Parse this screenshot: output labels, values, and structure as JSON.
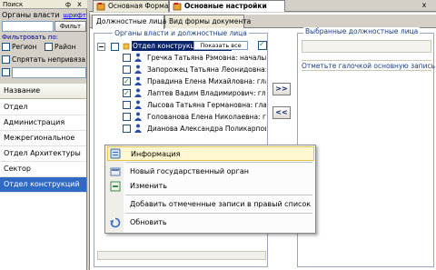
{
  "left_panel": {
    "title": "Поиск",
    "pin_glyph": "ф",
    "close_glyph": "x",
    "org_label": "Органы власти и ...",
    "font_link": "шрифт",
    "filter_button": "Фильт",
    "filter_by": "Фильтровать по:",
    "region_label": "Регион",
    "district_label": "Район",
    "hide_unlinked_label": "Спрятать непривяза",
    "list_header": "Название",
    "items": [
      {
        "label": "Отдел",
        "selected": false
      },
      {
        "label": "Администрация",
        "selected": false
      },
      {
        "label": "Межрегиональное",
        "selected": false
      },
      {
        "label": "Отдел Архитектуры",
        "selected": false
      },
      {
        "label": "Сектор",
        "selected": false
      },
      {
        "label": "Отдел конструкций",
        "selected": true
      }
    ]
  },
  "tabs": {
    "main_form": "Основная Форма",
    "settings": "Основные настройки",
    "close_glyph": "x"
  },
  "subtabs": {
    "positions": "Должностные лица",
    "doc_forms": "Вид формы документа"
  },
  "org_group": {
    "title": "Органы власти и должностные лица",
    "show_all": "Показать все",
    "show_all_checked": true,
    "root": "Отдел конструкций служ...",
    "people": [
      {
        "name": "Гречка Татьяна Рэмовна:  начальник",
        "checked": false
      },
      {
        "name": "Запорожец Татьяна Леонидовна:  глав",
        "checked": false
      },
      {
        "name": "Правдина Елена Михайловна:  глав",
        "checked": true
      },
      {
        "name": "Лаптев Вадим Владимирович:  главн",
        "checked": true
      },
      {
        "name": "Лысова Татьяна Германовна:  главн",
        "checked": false
      },
      {
        "name": "Голованова Елена Николаевна:  глав",
        "checked": false
      },
      {
        "name": "Дианова Александра Поликарповна",
        "checked": false
      }
    ]
  },
  "transfer": {
    "add": ">>",
    "remove": "<<"
  },
  "selected_group": {
    "title": "Выбранные должностные лица",
    "hint": "Отметьте галочкой основную запись"
  },
  "context_menu": {
    "items": [
      {
        "label": "Информация",
        "icon": "info-icon",
        "highlighted": true
      },
      {
        "label": "Новый государственный орган",
        "icon": "new-org-icon",
        "highlighted": false
      },
      {
        "label": "Изменить",
        "icon": "edit-icon",
        "highlighted": false
      },
      {
        "label": "Добавить отмеченные записи в правый список",
        "icon": "",
        "highlighted": false
      },
      {
        "label": "Обновить",
        "icon": "refresh-icon",
        "highlighted": false
      }
    ]
  },
  "colors": {
    "selection": "#316ac5",
    "menu_highlight": "#fff7d1",
    "group_title": "#1a3e80"
  }
}
